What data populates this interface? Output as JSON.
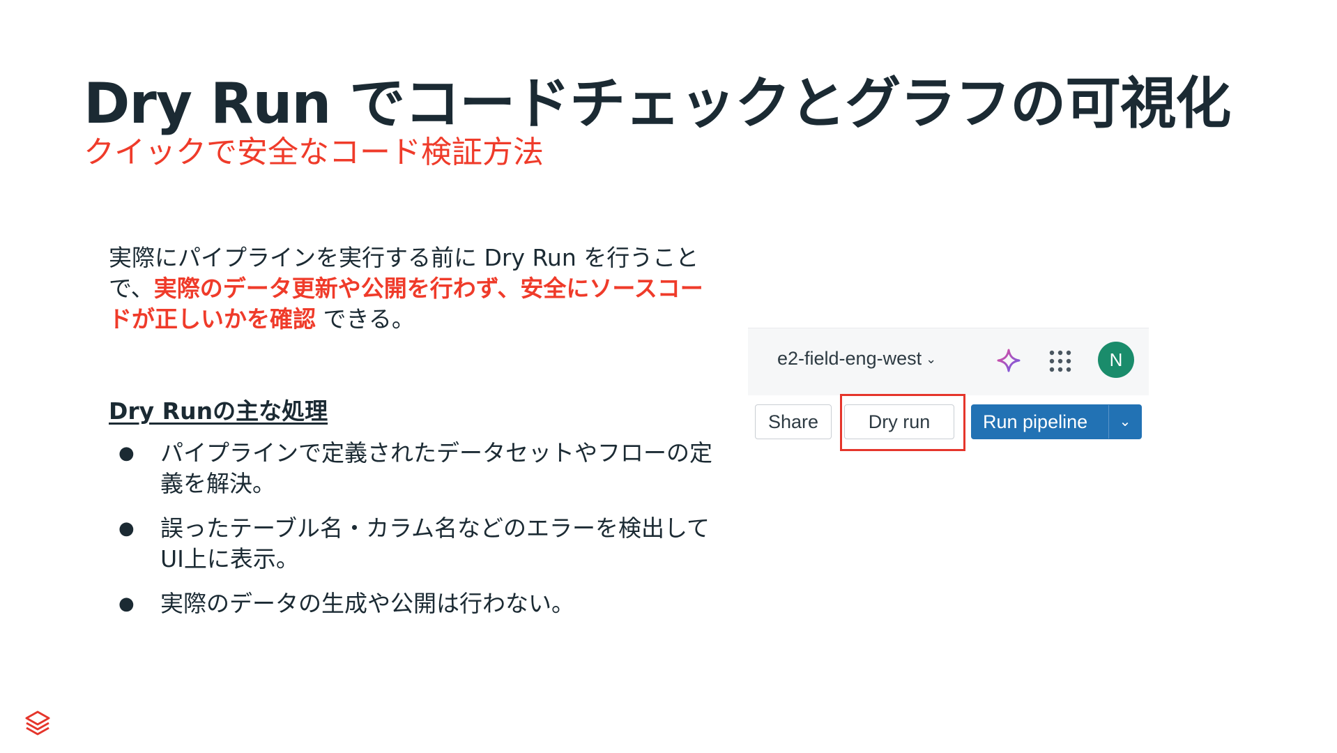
{
  "slide": {
    "title": "Dry Run でコードチェックとグラフの可視化",
    "subtitle": "クイックで安全なコード検証方法",
    "intro": {
      "part1": "実際にパイプラインを実行する前に Dry Run を行うことで、",
      "highlight": "実際のデータ更新や公開を行わず、安全にソースコードが正しいかを確認",
      "part2": " できる。"
    },
    "section_heading": "Dry Runの主な処理",
    "bullets": [
      "パイプラインで定義されたデータセットやフローの定義を解決。",
      "誤ったテーブル名・カラム名などのエラーを検出してUI上に表示。",
      "実際のデータの生成や公開は行わない。"
    ],
    "bullet_symbol": "●"
  },
  "ui_screenshot": {
    "workspace": "e2-field-eng-west",
    "workspace_chevron": "⌄",
    "avatar_letter": "N",
    "share_label": "Share",
    "dry_run_label": "Dry run",
    "run_pipeline_label": "Run pipeline",
    "run_pipeline_caret": "⌄",
    "icons": [
      "sparkle-icon",
      "apps-grid-icon",
      "avatar"
    ],
    "colors": {
      "accent_red": "#ef3b2a",
      "primary_blue": "#2272b4",
      "avatar_green": "#1a8c6b",
      "title_dark": "#1b2a33"
    }
  },
  "footer": {
    "logo_icon": "databricks-logo-icon"
  }
}
